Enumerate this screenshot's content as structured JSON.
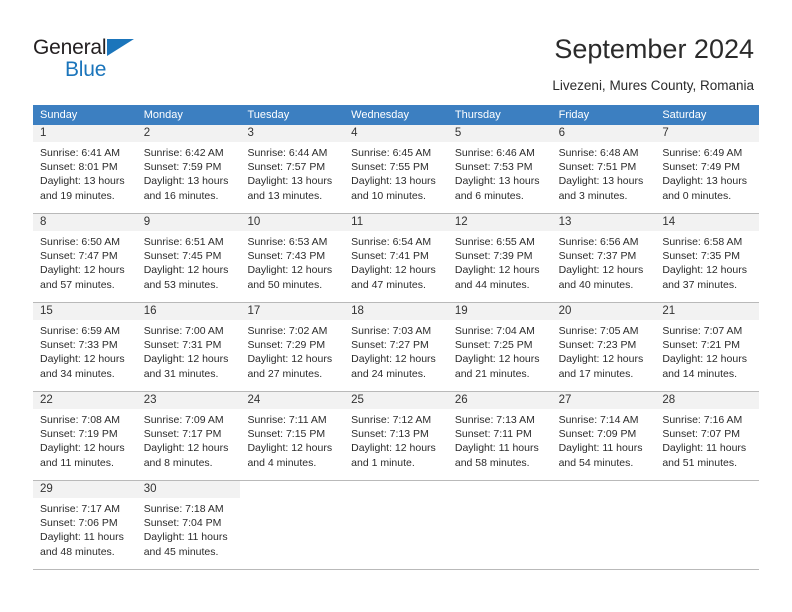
{
  "brand": {
    "name_part1": "General",
    "name_part2": "Blue",
    "triangle_color": "#1b75bb"
  },
  "header": {
    "title": "September 2024",
    "subtitle": "Livezeni, Mures County, Romania"
  },
  "colors": {
    "header_row_bg": "#3c7fc1",
    "daynum_bg": "#f2f2f2",
    "grid_line": "#b9b9b9",
    "brand_blue": "#1b75bb"
  },
  "calendar": {
    "weekday_headers": [
      "Sunday",
      "Monday",
      "Tuesday",
      "Wednesday",
      "Thursday",
      "Friday",
      "Saturday"
    ],
    "labels": {
      "sunrise": "Sunrise:",
      "sunset": "Sunset:",
      "daylight": "Daylight:"
    },
    "weeks": [
      [
        {
          "day": "1",
          "sunrise": "Sunrise: 6:41 AM",
          "sunset": "Sunset: 8:01 PM",
          "daylight_line1": "Daylight: 13 hours",
          "daylight_line2": "and 19 minutes."
        },
        {
          "day": "2",
          "sunrise": "Sunrise: 6:42 AM",
          "sunset": "Sunset: 7:59 PM",
          "daylight_line1": "Daylight: 13 hours",
          "daylight_line2": "and 16 minutes."
        },
        {
          "day": "3",
          "sunrise": "Sunrise: 6:44 AM",
          "sunset": "Sunset: 7:57 PM",
          "daylight_line1": "Daylight: 13 hours",
          "daylight_line2": "and 13 minutes."
        },
        {
          "day": "4",
          "sunrise": "Sunrise: 6:45 AM",
          "sunset": "Sunset: 7:55 PM",
          "daylight_line1": "Daylight: 13 hours",
          "daylight_line2": "and 10 minutes."
        },
        {
          "day": "5",
          "sunrise": "Sunrise: 6:46 AM",
          "sunset": "Sunset: 7:53 PM",
          "daylight_line1": "Daylight: 13 hours",
          "daylight_line2": "and 6 minutes."
        },
        {
          "day": "6",
          "sunrise": "Sunrise: 6:48 AM",
          "sunset": "Sunset: 7:51 PM",
          "daylight_line1": "Daylight: 13 hours",
          "daylight_line2": "and 3 minutes."
        },
        {
          "day": "7",
          "sunrise": "Sunrise: 6:49 AM",
          "sunset": "Sunset: 7:49 PM",
          "daylight_line1": "Daylight: 13 hours",
          "daylight_line2": "and 0 minutes."
        }
      ],
      [
        {
          "day": "8",
          "sunrise": "Sunrise: 6:50 AM",
          "sunset": "Sunset: 7:47 PM",
          "daylight_line1": "Daylight: 12 hours",
          "daylight_line2": "and 57 minutes."
        },
        {
          "day": "9",
          "sunrise": "Sunrise: 6:51 AM",
          "sunset": "Sunset: 7:45 PM",
          "daylight_line1": "Daylight: 12 hours",
          "daylight_line2": "and 53 minutes."
        },
        {
          "day": "10",
          "sunrise": "Sunrise: 6:53 AM",
          "sunset": "Sunset: 7:43 PM",
          "daylight_line1": "Daylight: 12 hours",
          "daylight_line2": "and 50 minutes."
        },
        {
          "day": "11",
          "sunrise": "Sunrise: 6:54 AM",
          "sunset": "Sunset: 7:41 PM",
          "daylight_line1": "Daylight: 12 hours",
          "daylight_line2": "and 47 minutes."
        },
        {
          "day": "12",
          "sunrise": "Sunrise: 6:55 AM",
          "sunset": "Sunset: 7:39 PM",
          "daylight_line1": "Daylight: 12 hours",
          "daylight_line2": "and 44 minutes."
        },
        {
          "day": "13",
          "sunrise": "Sunrise: 6:56 AM",
          "sunset": "Sunset: 7:37 PM",
          "daylight_line1": "Daylight: 12 hours",
          "daylight_line2": "and 40 minutes."
        },
        {
          "day": "14",
          "sunrise": "Sunrise: 6:58 AM",
          "sunset": "Sunset: 7:35 PM",
          "daylight_line1": "Daylight: 12 hours",
          "daylight_line2": "and 37 minutes."
        }
      ],
      [
        {
          "day": "15",
          "sunrise": "Sunrise: 6:59 AM",
          "sunset": "Sunset: 7:33 PM",
          "daylight_line1": "Daylight: 12 hours",
          "daylight_line2": "and 34 minutes."
        },
        {
          "day": "16",
          "sunrise": "Sunrise: 7:00 AM",
          "sunset": "Sunset: 7:31 PM",
          "daylight_line1": "Daylight: 12 hours",
          "daylight_line2": "and 31 minutes."
        },
        {
          "day": "17",
          "sunrise": "Sunrise: 7:02 AM",
          "sunset": "Sunset: 7:29 PM",
          "daylight_line1": "Daylight: 12 hours",
          "daylight_line2": "and 27 minutes."
        },
        {
          "day": "18",
          "sunrise": "Sunrise: 7:03 AM",
          "sunset": "Sunset: 7:27 PM",
          "daylight_line1": "Daylight: 12 hours",
          "daylight_line2": "and 24 minutes."
        },
        {
          "day": "19",
          "sunrise": "Sunrise: 7:04 AM",
          "sunset": "Sunset: 7:25 PM",
          "daylight_line1": "Daylight: 12 hours",
          "daylight_line2": "and 21 minutes."
        },
        {
          "day": "20",
          "sunrise": "Sunrise: 7:05 AM",
          "sunset": "Sunset: 7:23 PM",
          "daylight_line1": "Daylight: 12 hours",
          "daylight_line2": "and 17 minutes."
        },
        {
          "day": "21",
          "sunrise": "Sunrise: 7:07 AM",
          "sunset": "Sunset: 7:21 PM",
          "daylight_line1": "Daylight: 12 hours",
          "daylight_line2": "and 14 minutes."
        }
      ],
      [
        {
          "day": "22",
          "sunrise": "Sunrise: 7:08 AM",
          "sunset": "Sunset: 7:19 PM",
          "daylight_line1": "Daylight: 12 hours",
          "daylight_line2": "and 11 minutes."
        },
        {
          "day": "23",
          "sunrise": "Sunrise: 7:09 AM",
          "sunset": "Sunset: 7:17 PM",
          "daylight_line1": "Daylight: 12 hours",
          "daylight_line2": "and 8 minutes."
        },
        {
          "day": "24",
          "sunrise": "Sunrise: 7:11 AM",
          "sunset": "Sunset: 7:15 PM",
          "daylight_line1": "Daylight: 12 hours",
          "daylight_line2": "and 4 minutes."
        },
        {
          "day": "25",
          "sunrise": "Sunrise: 7:12 AM",
          "sunset": "Sunset: 7:13 PM",
          "daylight_line1": "Daylight: 12 hours",
          "daylight_line2": "and 1 minute."
        },
        {
          "day": "26",
          "sunrise": "Sunrise: 7:13 AM",
          "sunset": "Sunset: 7:11 PM",
          "daylight_line1": "Daylight: 11 hours",
          "daylight_line2": "and 58 minutes."
        },
        {
          "day": "27",
          "sunrise": "Sunrise: 7:14 AM",
          "sunset": "Sunset: 7:09 PM",
          "daylight_line1": "Daylight: 11 hours",
          "daylight_line2": "and 54 minutes."
        },
        {
          "day": "28",
          "sunrise": "Sunrise: 7:16 AM",
          "sunset": "Sunset: 7:07 PM",
          "daylight_line1": "Daylight: 11 hours",
          "daylight_line2": "and 51 minutes."
        }
      ],
      [
        {
          "day": "29",
          "sunrise": "Sunrise: 7:17 AM",
          "sunset": "Sunset: 7:06 PM",
          "daylight_line1": "Daylight: 11 hours",
          "daylight_line2": "and 48 minutes."
        },
        {
          "day": "30",
          "sunrise": "Sunrise: 7:18 AM",
          "sunset": "Sunset: 7:04 PM",
          "daylight_line1": "Daylight: 11 hours",
          "daylight_line2": "and 45 minutes."
        },
        {
          "day": "",
          "sunrise": "",
          "sunset": "",
          "daylight_line1": "",
          "daylight_line2": ""
        },
        {
          "day": "",
          "sunrise": "",
          "sunset": "",
          "daylight_line1": "",
          "daylight_line2": ""
        },
        {
          "day": "",
          "sunrise": "",
          "sunset": "",
          "daylight_line1": "",
          "daylight_line2": ""
        },
        {
          "day": "",
          "sunrise": "",
          "sunset": "",
          "daylight_line1": "",
          "daylight_line2": ""
        },
        {
          "day": "",
          "sunrise": "",
          "sunset": "",
          "daylight_line1": "",
          "daylight_line2": ""
        }
      ]
    ]
  }
}
